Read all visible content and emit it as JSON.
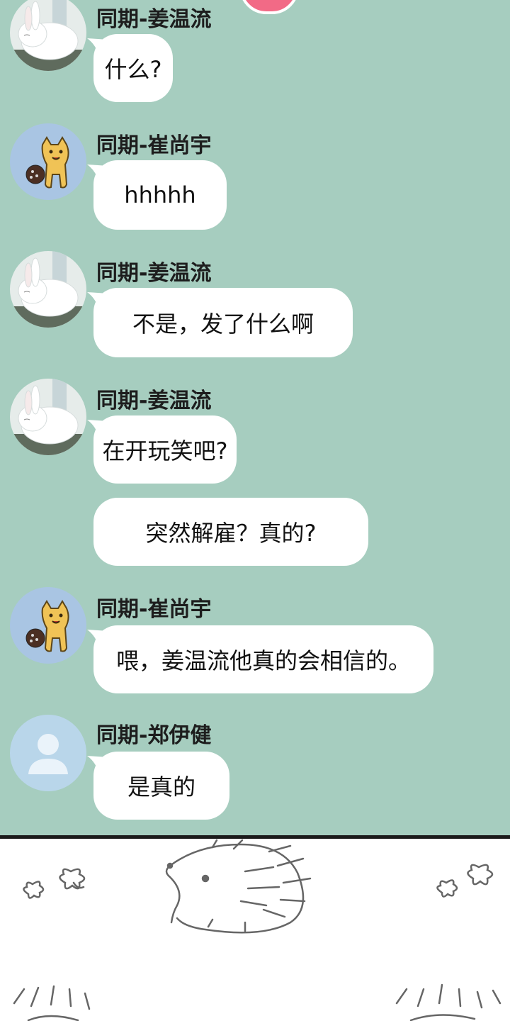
{
  "messages": [
    {
      "sender": "同期-姜温流",
      "text": "什么?",
      "avatar": "rabbit-avatar"
    },
    {
      "sender": "同期-崔尚宇",
      "text": "hhhhh",
      "avatar": "cat-avatar"
    },
    {
      "sender": "同期-姜温流",
      "text": "不是，发了什么啊",
      "avatar": "rabbit-avatar"
    },
    {
      "sender": "同期-姜温流",
      "text": "在开玩笑吧?",
      "avatar": "rabbit-avatar"
    },
    {
      "sender": "",
      "text": "突然解雇？真的?",
      "avatar": ""
    },
    {
      "sender": "同期-崔尚宇",
      "text": "喂，姜温流他真的会相信的。",
      "avatar": "cat-avatar"
    },
    {
      "sender": "同期-郑伊健",
      "text": "是真的",
      "avatar": "default-user-avatar"
    }
  ],
  "colors": {
    "chat_background": "#a6cdbf",
    "bubble": "#ffffff",
    "default_avatar_bg": "#b9d6ea",
    "accent_pink": "#f26a86"
  },
  "decorations": [
    "hedgehog-drawing",
    "clover-doodle"
  ]
}
